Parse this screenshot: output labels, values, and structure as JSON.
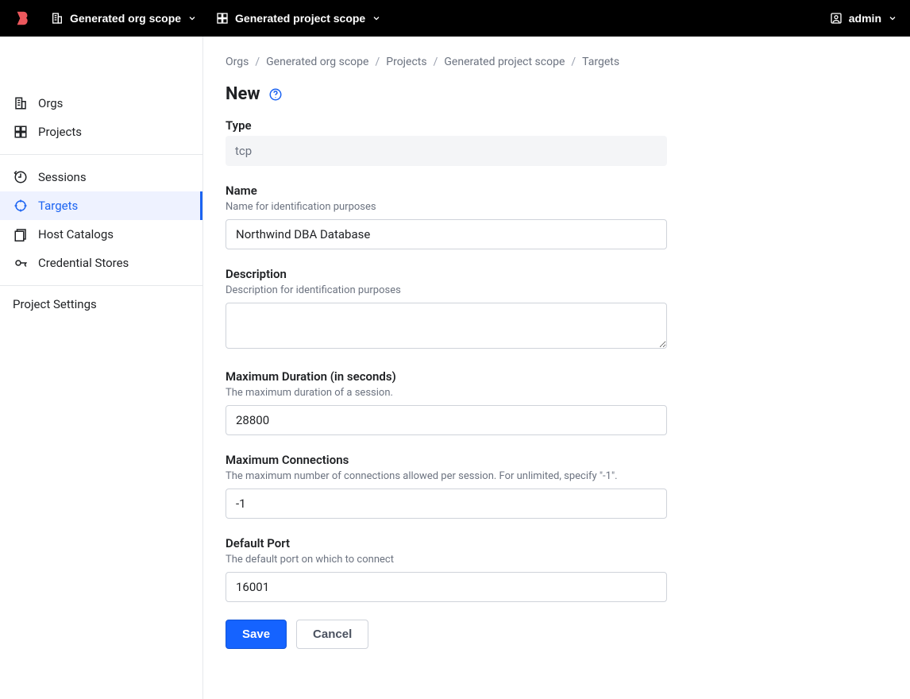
{
  "header": {
    "org_scope_label": "Generated org scope",
    "project_scope_label": "Generated project scope",
    "user_label": "admin"
  },
  "sidebar": {
    "items": [
      {
        "label": "Orgs",
        "icon": "org-icon"
      },
      {
        "label": "Projects",
        "icon": "projects-icon"
      },
      {
        "label": "Sessions",
        "icon": "sessions-icon"
      },
      {
        "label": "Targets",
        "icon": "targets-icon",
        "active": true
      },
      {
        "label": "Host Catalogs",
        "icon": "host-catalogs-icon"
      },
      {
        "label": "Credential Stores",
        "icon": "credential-stores-icon"
      }
    ],
    "settings_label": "Project Settings"
  },
  "breadcrumbs": [
    "Orgs",
    "Generated org scope",
    "Projects",
    "Generated project scope",
    "Targets"
  ],
  "page": {
    "title": "New"
  },
  "form": {
    "type": {
      "label": "Type",
      "value": "tcp"
    },
    "name": {
      "label": "Name",
      "hint": "Name for identification purposes",
      "value": "Northwind DBA Database"
    },
    "description": {
      "label": "Description",
      "hint": "Description for identification purposes",
      "value": ""
    },
    "max_duration": {
      "label": "Maximum Duration (in seconds)",
      "hint": "The maximum duration of a session.",
      "value": "28800"
    },
    "max_connections": {
      "label": "Maximum Connections",
      "hint": "The maximum number of connections allowed per session. For unlimited, specify \"-1\".",
      "value": "-1"
    },
    "default_port": {
      "label": "Default Port",
      "hint": "The default port on which to connect",
      "value": "16001"
    },
    "actions": {
      "save": "Save",
      "cancel": "Cancel"
    }
  }
}
